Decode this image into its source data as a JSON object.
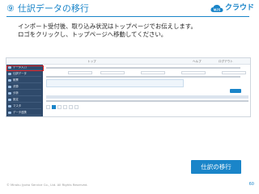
{
  "header": {
    "number": "⑨",
    "title": "仕訳データの移行"
  },
  "logo": {
    "text": "クラウド",
    "brand_color": "#1a85c9"
  },
  "description": {
    "line1": "インポート受付後、取り込み状況はトップページでお伝えします。",
    "line2": "ロゴをクリックし、トップページへ移動してください。"
  },
  "screenshot": {
    "logo_text": "MJS",
    "top_links": [
      "トップ",
      "ヘルプ",
      "ログアウト"
    ],
    "sidebar_items": [
      "データ入力",
      "仕訳データ",
      "帳票",
      "決算",
      "分析",
      "設定",
      "マスタ",
      "データ連携"
    ],
    "highlight_color": "#e02020"
  },
  "cta": {
    "label": "仕訳の移行"
  },
  "footer": {
    "copyright": "© Miroku Jyoho Service Co., Ltd. All Rights Reserved.",
    "page_number": "60"
  }
}
